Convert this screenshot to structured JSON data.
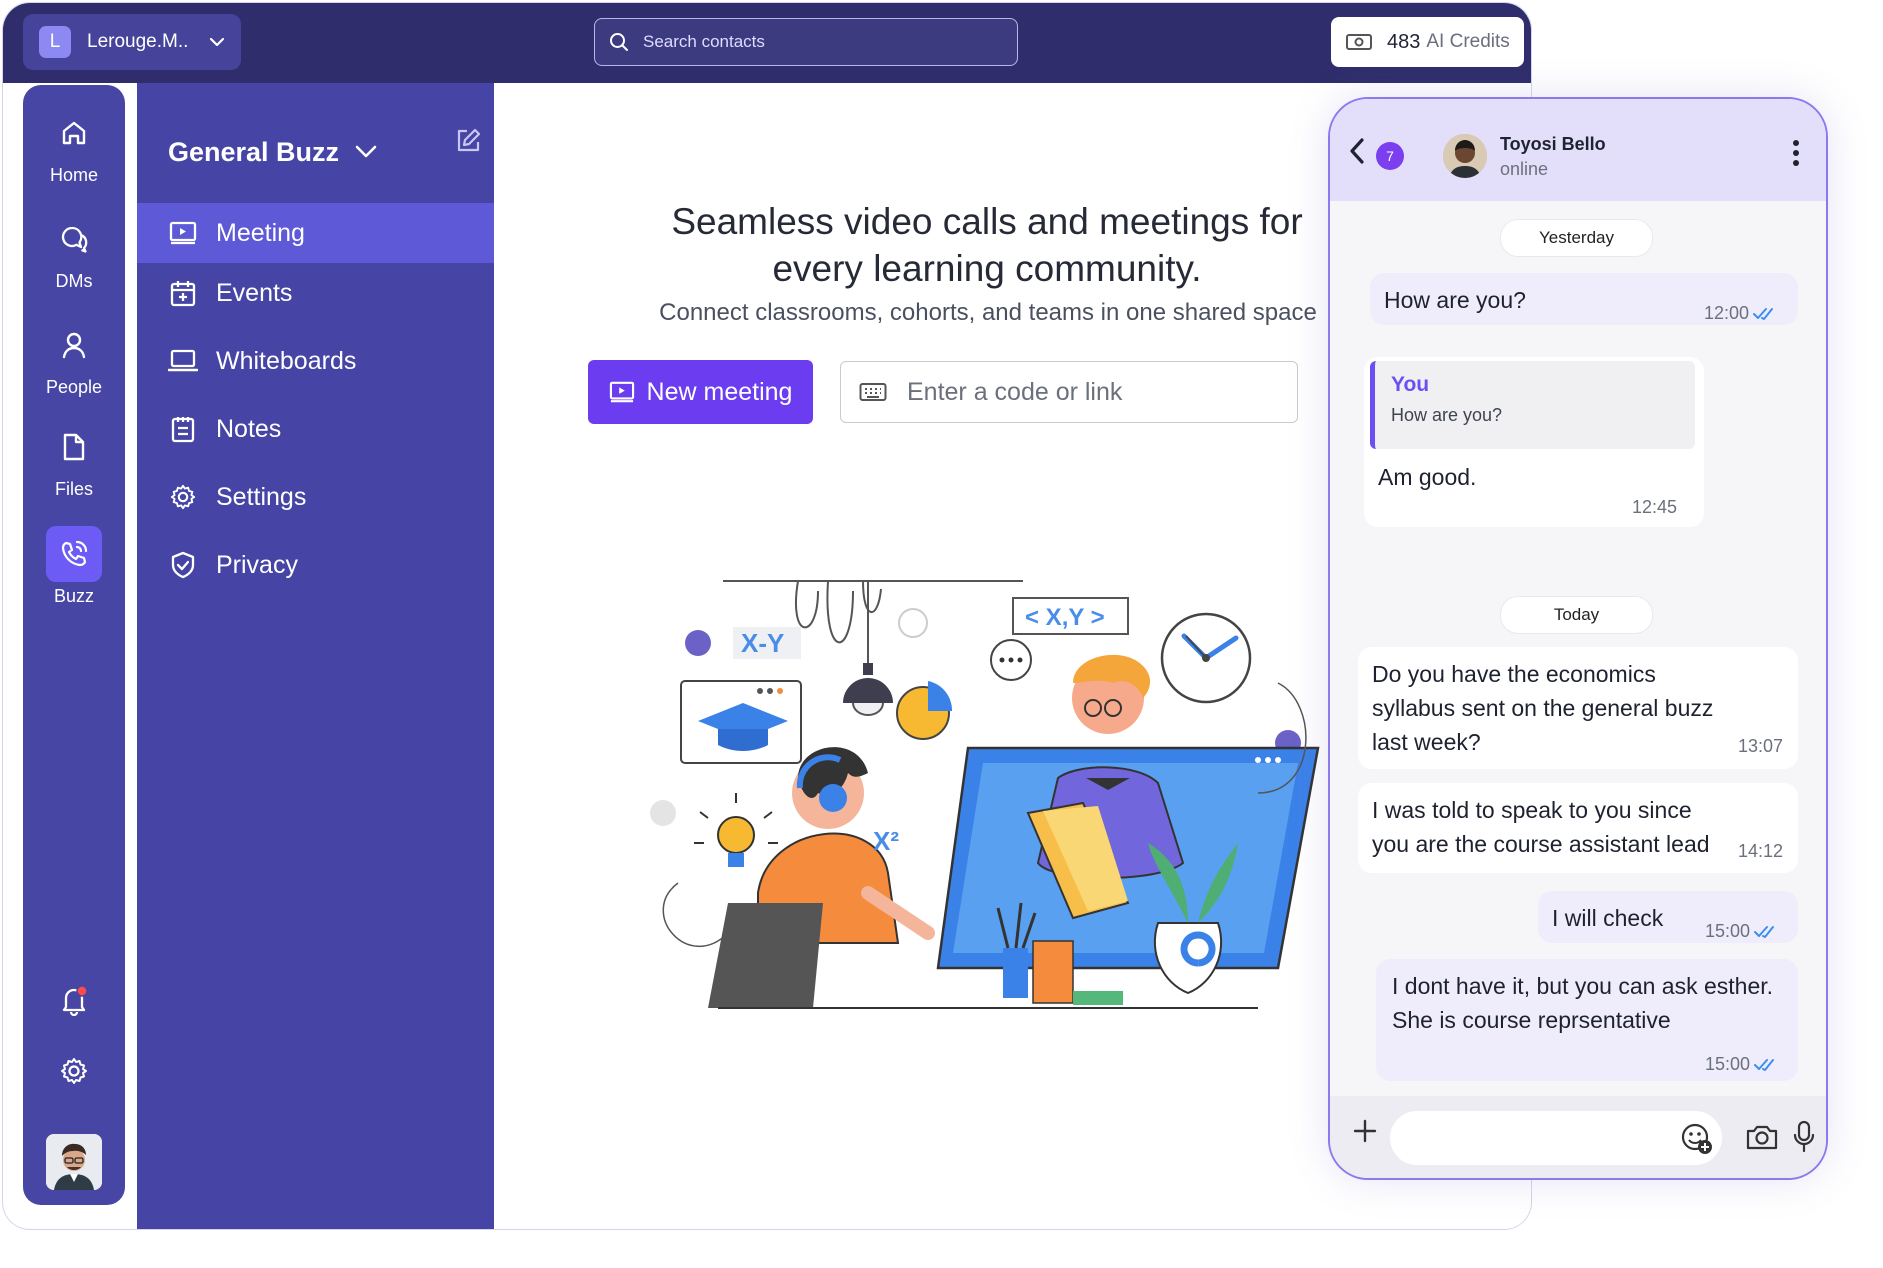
{
  "topbar": {
    "workspace_initial": "L",
    "workspace_name": "Lerouge.M..",
    "search_placeholder": "Search contacts",
    "credits_value": "483",
    "credits_label": "AI Credits"
  },
  "rail": {
    "items": [
      {
        "label": "Home",
        "icon": "home-icon"
      },
      {
        "label": "DMs",
        "icon": "chat-icon"
      },
      {
        "label": "People",
        "icon": "person-icon"
      },
      {
        "label": "Files",
        "icon": "file-icon"
      },
      {
        "label": "Buzz",
        "icon": "phone-call-icon"
      }
    ],
    "active": "Buzz"
  },
  "sidebar": {
    "title": "General Buzz",
    "items": [
      {
        "label": "Meeting",
        "icon": "meeting-icon"
      },
      {
        "label": "Events",
        "icon": "calendar-icon"
      },
      {
        "label": "Whiteboards",
        "icon": "whiteboard-icon"
      },
      {
        "label": "Notes",
        "icon": "notes-icon"
      },
      {
        "label": "Settings",
        "icon": "gear-icon"
      },
      {
        "label": "Privacy",
        "icon": "shield-icon"
      }
    ],
    "active": "Meeting"
  },
  "main": {
    "headline": "Seamless video calls and meetings for every learning community.",
    "subheadline": "Connect classrooms, cohorts, and teams in one shared space",
    "new_meeting_label": "New meeting",
    "code_placeholder": "Enter a code or link",
    "illustration_labels": {
      "formula": "X-Y",
      "code_tag": "< X,Y >",
      "power": "X²"
    }
  },
  "chat": {
    "unread_count": "7",
    "contact_name": "Toyosi Bello",
    "contact_status": "online",
    "days": {
      "yesterday": "Yesterday",
      "today": "Today"
    },
    "messages": [
      {
        "text": "How are you?",
        "time": "12:00",
        "direction": "out"
      },
      {
        "reply_author": "You",
        "reply_text": "How are you?",
        "text": "Am good.",
        "time": "12:45",
        "direction": "in"
      },
      {
        "text": "Do you have the economics syllabus sent on the general buzz last week?",
        "time": "13:07",
        "direction": "in"
      },
      {
        "text": "I was told to speak to you since you are the course assistant lead",
        "time": "14:12",
        "direction": "in"
      },
      {
        "text": "I will check",
        "time": "15:00",
        "direction": "out"
      },
      {
        "text": "I dont have it, but you can ask esther. She is course reprsentative",
        "time": "15:00",
        "direction": "out"
      }
    ],
    "colors": {
      "accent": "#6b3cf0",
      "tick": "#3b8ef0"
    }
  }
}
